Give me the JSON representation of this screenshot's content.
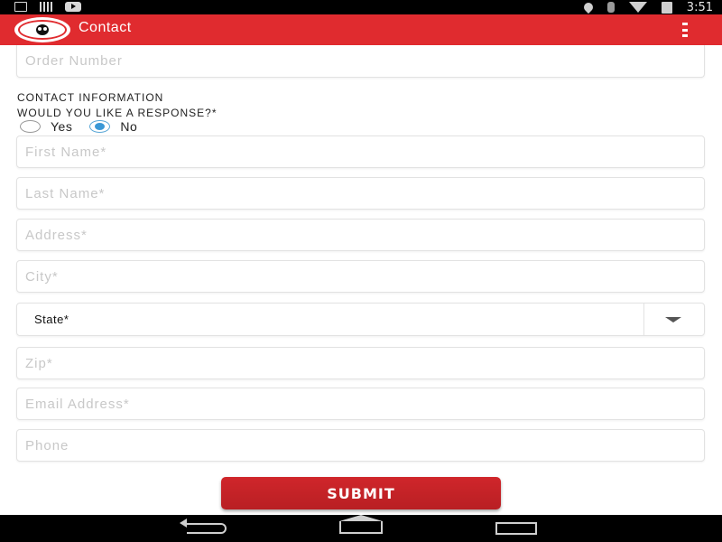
{
  "status_bar": {
    "time": "3:51"
  },
  "app_bar": {
    "title": "Contact",
    "logo_alt": "PANDA EXPRESS"
  },
  "form": {
    "order_number": {
      "placeholder": "Order Number",
      "value": ""
    },
    "contact_heading": "CONTACT INFORMATION",
    "response_question": "WOULD YOU LIKE A RESPONSE?*",
    "response_options": [
      {
        "label": "Yes",
        "checked": false
      },
      {
        "label": "No",
        "checked": true
      }
    ],
    "first_name": {
      "placeholder": "First Name*",
      "value": ""
    },
    "last_name": {
      "placeholder": "Last Name*",
      "value": ""
    },
    "address": {
      "placeholder": "Address*",
      "value": ""
    },
    "city": {
      "placeholder": "City*",
      "value": ""
    },
    "state": {
      "selected": "State*"
    },
    "zip": {
      "placeholder": "Zip*",
      "value": ""
    },
    "email": {
      "placeholder": "Email Address*",
      "value": ""
    },
    "phone": {
      "placeholder": "Phone",
      "value": ""
    },
    "submit_label": "SUBMIT"
  },
  "colors": {
    "brand_red": "#e02b2f",
    "radio_accent": "#3a98d6",
    "placeholder": "#c8c8c8"
  }
}
